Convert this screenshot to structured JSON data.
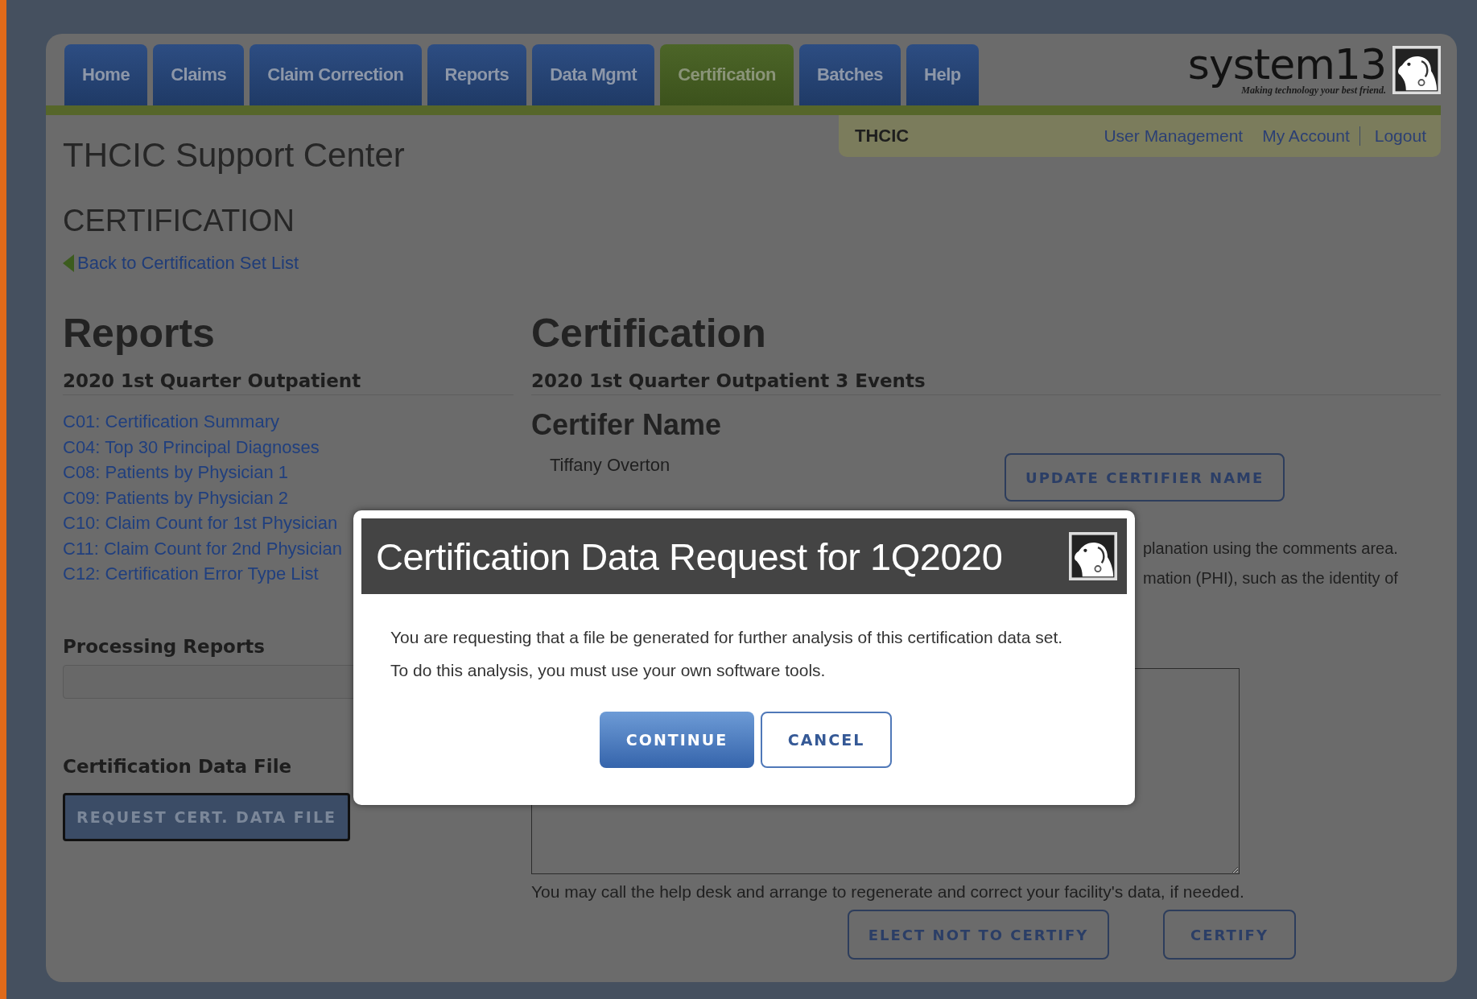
{
  "nav": {
    "tabs": [
      {
        "label": "Home",
        "selected": false
      },
      {
        "label": "Claims",
        "selected": false
      },
      {
        "label": "Claim Correction",
        "selected": false
      },
      {
        "label": "Reports",
        "selected": false
      },
      {
        "label": "Data Mgmt",
        "selected": false
      },
      {
        "label": "Certification",
        "selected": true
      },
      {
        "label": "Batches",
        "selected": false
      },
      {
        "label": "Help",
        "selected": false
      }
    ],
    "logo": {
      "text": "system13",
      "tagline": "Making technology your best friend."
    }
  },
  "subbar": {
    "org": "THCIC",
    "links": [
      "User Management",
      "My Account",
      "Logout"
    ]
  },
  "page": {
    "title": "THCIC Support Center",
    "section": "CERTIFICATION",
    "back_link": "Back to Certification Set List"
  },
  "reports": {
    "heading": "Reports",
    "subheading": "2020 1st Quarter Outpatient",
    "links": [
      "C01: Certification Summary",
      "C04: Top 30 Principal Diagnoses",
      "C08: Patients by Physician 1",
      "C09: Patients by Physician 2",
      "C10: Claim Count for 1st Physician",
      "C11: Claim Count for 2nd Physician",
      "C12: Certification Error Type List"
    ],
    "processing": {
      "heading": "Processing Reports"
    },
    "data_file": {
      "heading": "Certification Data File",
      "button": "REQUEST CERT. DATA FILE"
    }
  },
  "certification": {
    "heading": "Certification",
    "subheading": "2020 1st Quarter Outpatient 3 Events",
    "certifier": {
      "heading": "Certifer Name",
      "name": "Tiffany Overton",
      "button": "UPDATE CERTIFIER NAME"
    },
    "notes": [
      "planation using the comments area.",
      "mation (PHI), such as the identity of"
    ],
    "help_text": "You may call the help desk and arrange to regenerate and correct your facility's data, if needed.",
    "buttons": [
      "ELECT NOT TO CERTIFY",
      "CERTIFY"
    ]
  },
  "modal": {
    "title": "Certification Data Request for 1Q2020",
    "lines": [
      "You are requesting that a file be generated for further analysis of this certification data set.",
      "To do this analysis, you must use your own software tools."
    ],
    "buttons": [
      {
        "label": "CONTINUE",
        "kind": "primary"
      },
      {
        "label": "CANCEL",
        "kind": "secondary"
      }
    ]
  }
}
